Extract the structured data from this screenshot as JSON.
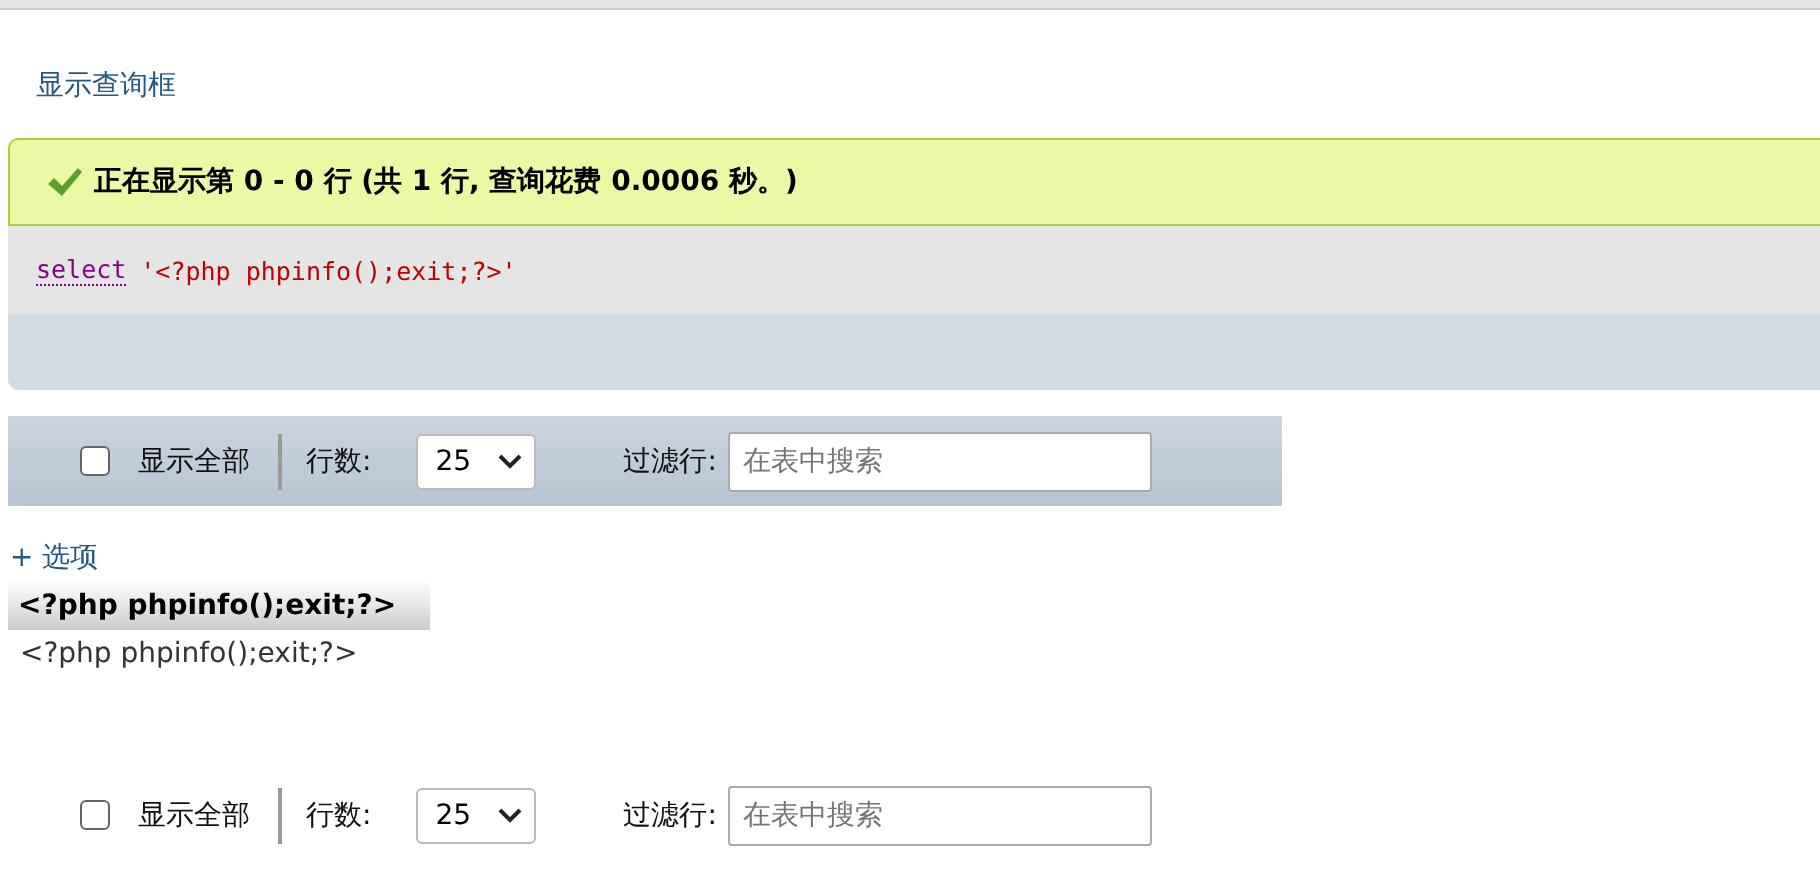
{
  "query_box_link": "显示查询框",
  "message": {
    "text": "正在显示第 0 - 0 行 (共 1 行, 查询花费 0.0006 秒。)"
  },
  "sql": {
    "keyword": "select",
    "literal": "'<?php phpinfo();exit;?>'"
  },
  "navigation_bars": [
    {
      "show_all": {
        "label": "显示全部",
        "checked": false
      },
      "rows_label": "行数:",
      "rows_value": "25",
      "filter_label": "过滤行:",
      "filter_placeholder": "在表中搜索",
      "shaded": true
    },
    {
      "show_all": {
        "label": "显示全部",
        "checked": false
      },
      "rows_label": "行数:",
      "rows_value": "25",
      "filter_label": "过滤行:",
      "filter_placeholder": "在表中搜索",
      "shaded": false
    }
  ],
  "options_link": "+ 选项",
  "table": {
    "columns": [
      "<?php phpinfo();exit;?>"
    ],
    "rows": [
      [
        "<?php phpinfo();exit;?>"
      ]
    ]
  }
}
